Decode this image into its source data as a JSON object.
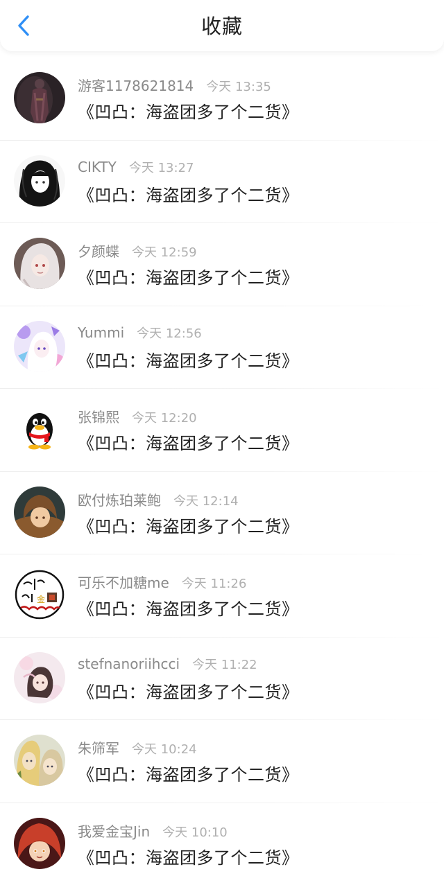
{
  "header": {
    "title": "收藏"
  },
  "items": [
    {
      "username": "游客1178621814",
      "time": "今天 13:35",
      "title": "《凹凸：海盗团多了个二货》",
      "avatar": "avatar-dark-figure"
    },
    {
      "username": "CIKTY",
      "time": "今天 13:27",
      "title": "《凹凸：海盗团多了个二货》",
      "avatar": "avatar-sketch-girl"
    },
    {
      "username": "夕颜蝶",
      "time": "今天 12:59",
      "title": "《凹凸：海盗团多了个二货》",
      "avatar": "avatar-white-hair-girl"
    },
    {
      "username": "Yummi",
      "time": "今天 12:56",
      "title": "《凹凸：海盗团多了个二货》",
      "avatar": "avatar-pastel-anime"
    },
    {
      "username": "张锦熙",
      "time": "今天 12:20",
      "title": "《凹凸：海盗团多了个二货》",
      "avatar": "avatar-qq-penguin"
    },
    {
      "username": "欧付炼珀莱鲍",
      "time": "今天 12:14",
      "title": "《凹凸：海盗团多了个二货》",
      "avatar": "avatar-brown-hair-boy"
    },
    {
      "username": "可乐不加糖me",
      "time": "今天 11:26",
      "title": "《凹凸：海盗团多了个二货》",
      "avatar": "avatar-handwriting"
    },
    {
      "username": "stefnanoriihcci",
      "time": "今天 11:22",
      "title": "《凹凸：海盗团多了个二货》",
      "avatar": "avatar-pink-anime"
    },
    {
      "username": "朱筛军",
      "time": "今天 10:24",
      "title": "《凹凸：海盗团多了个二货》",
      "avatar": "avatar-elves"
    },
    {
      "username": "我爱金宝Jin",
      "time": "今天 10:10",
      "title": "《凹凸：海盗团多了个二货》",
      "avatar": "avatar-red-hair-anime"
    }
  ],
  "colors": {
    "accent": "#2f8ff6",
    "username": "#8a8a8a",
    "time": "#b0b0b0",
    "title": "#222222"
  }
}
